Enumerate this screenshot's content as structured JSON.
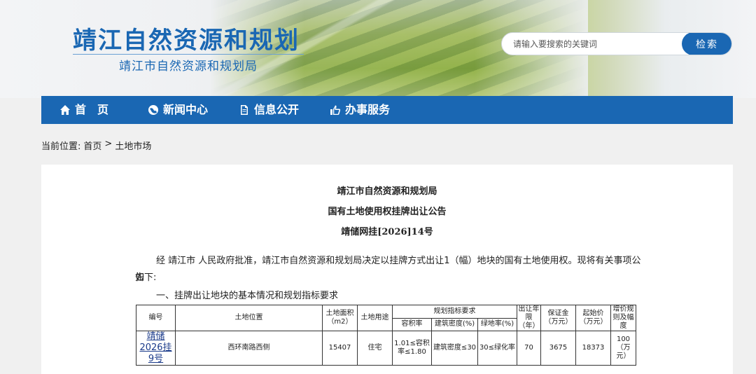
{
  "header": {
    "title": "靖江自然资源和规划",
    "subtitle": "靖江市自然资源和规划局"
  },
  "search": {
    "placeholder": "请输入要搜索的关键词",
    "button_label": "检索"
  },
  "nav": {
    "items": [
      {
        "label": "首　页",
        "icon": "home-icon"
      },
      {
        "label": "新闻中心",
        "icon": "globe-icon"
      },
      {
        "label": "信息公开",
        "icon": "document-icon"
      },
      {
        "label": "办事服务",
        "icon": "thumbs-up-icon"
      }
    ]
  },
  "breadcrumb": {
    "prefix": "当前位置:",
    "home": "首页",
    "separator": ">",
    "current": "土地市场"
  },
  "notice": {
    "agency": "靖江市自然资源和规划局",
    "title": "国有土地使用权挂牌出让公告",
    "number": "靖储网挂[2026]14号",
    "intro_line1": "经 靖江市 人民政府批准，靖江市自然资源和规划局决定以挂牌方式出让1（幅）地块的国有土地使用权。现将有关事项公告",
    "intro_line2": "如下:",
    "section1": "一、挂牌出让地块的基本情况和规划指标要求"
  },
  "table": {
    "headers": {
      "id": "编号",
      "location": "土地位置",
      "area": "土地面积（m2）",
      "use": "土地用途",
      "planning": "规划指标要求",
      "far": "容积率",
      "density": "建筑密度(%)",
      "green": "绿地率(%)",
      "term": "出让年限（年）",
      "deposit": "保证金（万元）",
      "start_price": "起始价（万元）",
      "increment": "增价规则及幅度"
    },
    "rows": [
      {
        "id": "靖储2026挂9号",
        "location": "西环南路西侧",
        "area": "15407",
        "use": "住宅",
        "far": "1.01≤容积率≤1.80",
        "density": "建筑密度≤30",
        "green": "30≤绿化率",
        "term": "70",
        "deposit": "3675",
        "start_price": "18373",
        "increment": "100（万元）"
      }
    ]
  },
  "colors": {
    "brand_blue": "#1a67b3",
    "page_bg": "#f0f0f0"
  }
}
